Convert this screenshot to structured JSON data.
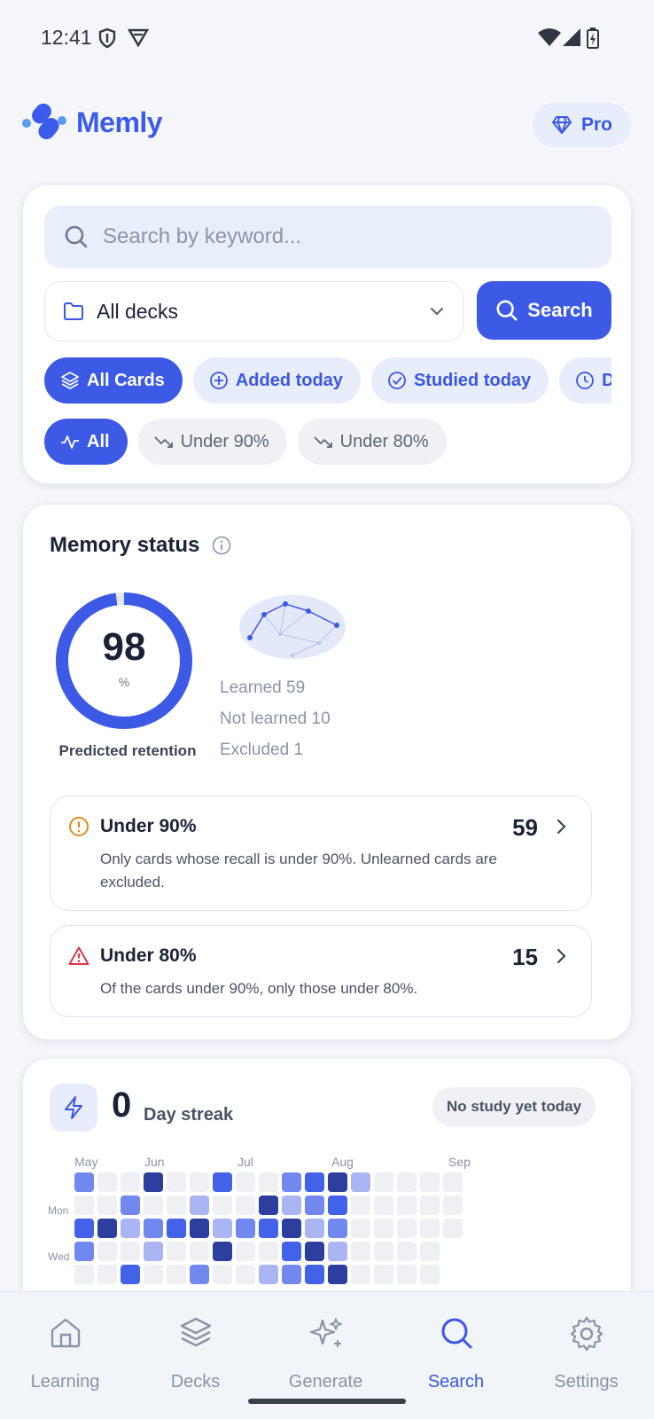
{
  "status_bar": {
    "time": "12:41"
  },
  "app": {
    "brand": "Memly",
    "pro_label": "Pro"
  },
  "search": {
    "placeholder": "Search by keyword...",
    "deck_select": "All decks",
    "search_button": "Search",
    "card_filters": [
      "All Cards",
      "Added today",
      "Studied today",
      "Due"
    ],
    "retention_filters": [
      "All",
      "Under 90%",
      "Under 80%"
    ]
  },
  "memory": {
    "title": "Memory status",
    "retention_value": "98",
    "retention_unit": "%",
    "retention_fraction": 0.98,
    "retention_caption": "Predicted retention",
    "learned": "Learned 59",
    "not_learned": "Not learned 10",
    "excluded": "Excluded 1",
    "under90": {
      "title": "Under 90%",
      "count": "59",
      "desc": "Only cards whose recall is under 90%. Unlearned cards are excluded."
    },
    "under80": {
      "title": "Under 80%",
      "count": "15",
      "desc": "Of the cards under 90%, only those under 80%."
    }
  },
  "streak": {
    "count": "0",
    "label": "Day streak",
    "status": "No study yet today",
    "months": [
      "May",
      "Jun",
      "Jul",
      "Aug",
      "Sep"
    ],
    "day_labels": [
      "Mon",
      "Wed"
    ],
    "heatmap_levels": [
      [
        2,
        0,
        0,
        4,
        0,
        0,
        3,
        0,
        0,
        2,
        3,
        4,
        1,
        0,
        0,
        0,
        0
      ],
      [
        0,
        0,
        2,
        0,
        0,
        1,
        0,
        0,
        4,
        1,
        2,
        3,
        0,
        0,
        0,
        0,
        0
      ],
      [
        3,
        4,
        1,
        2,
        3,
        4,
        1,
        2,
        3,
        4,
        1,
        2,
        0,
        0,
        0,
        0,
        0
      ],
      [
        2,
        0,
        0,
        1,
        0,
        0,
        4,
        0,
        0,
        3,
        4,
        1,
        0,
        0,
        0,
        0
      ],
      [
        0,
        0,
        3,
        0,
        0,
        2,
        0,
        0,
        1,
        2,
        3,
        4,
        0,
        0,
        0,
        0
      ]
    ],
    "colors": [
      "#eef0f4",
      "#aab6f4",
      "#7188ee",
      "#4262e8",
      "#2c3e9e"
    ]
  },
  "nav": {
    "items": [
      {
        "label": "Learning",
        "icon": "home-icon"
      },
      {
        "label": "Decks",
        "icon": "layers-icon"
      },
      {
        "label": "Generate",
        "icon": "sparkles-icon"
      },
      {
        "label": "Search",
        "icon": "search-icon"
      },
      {
        "label": "Settings",
        "icon": "gear-icon"
      }
    ],
    "active": "Search"
  }
}
